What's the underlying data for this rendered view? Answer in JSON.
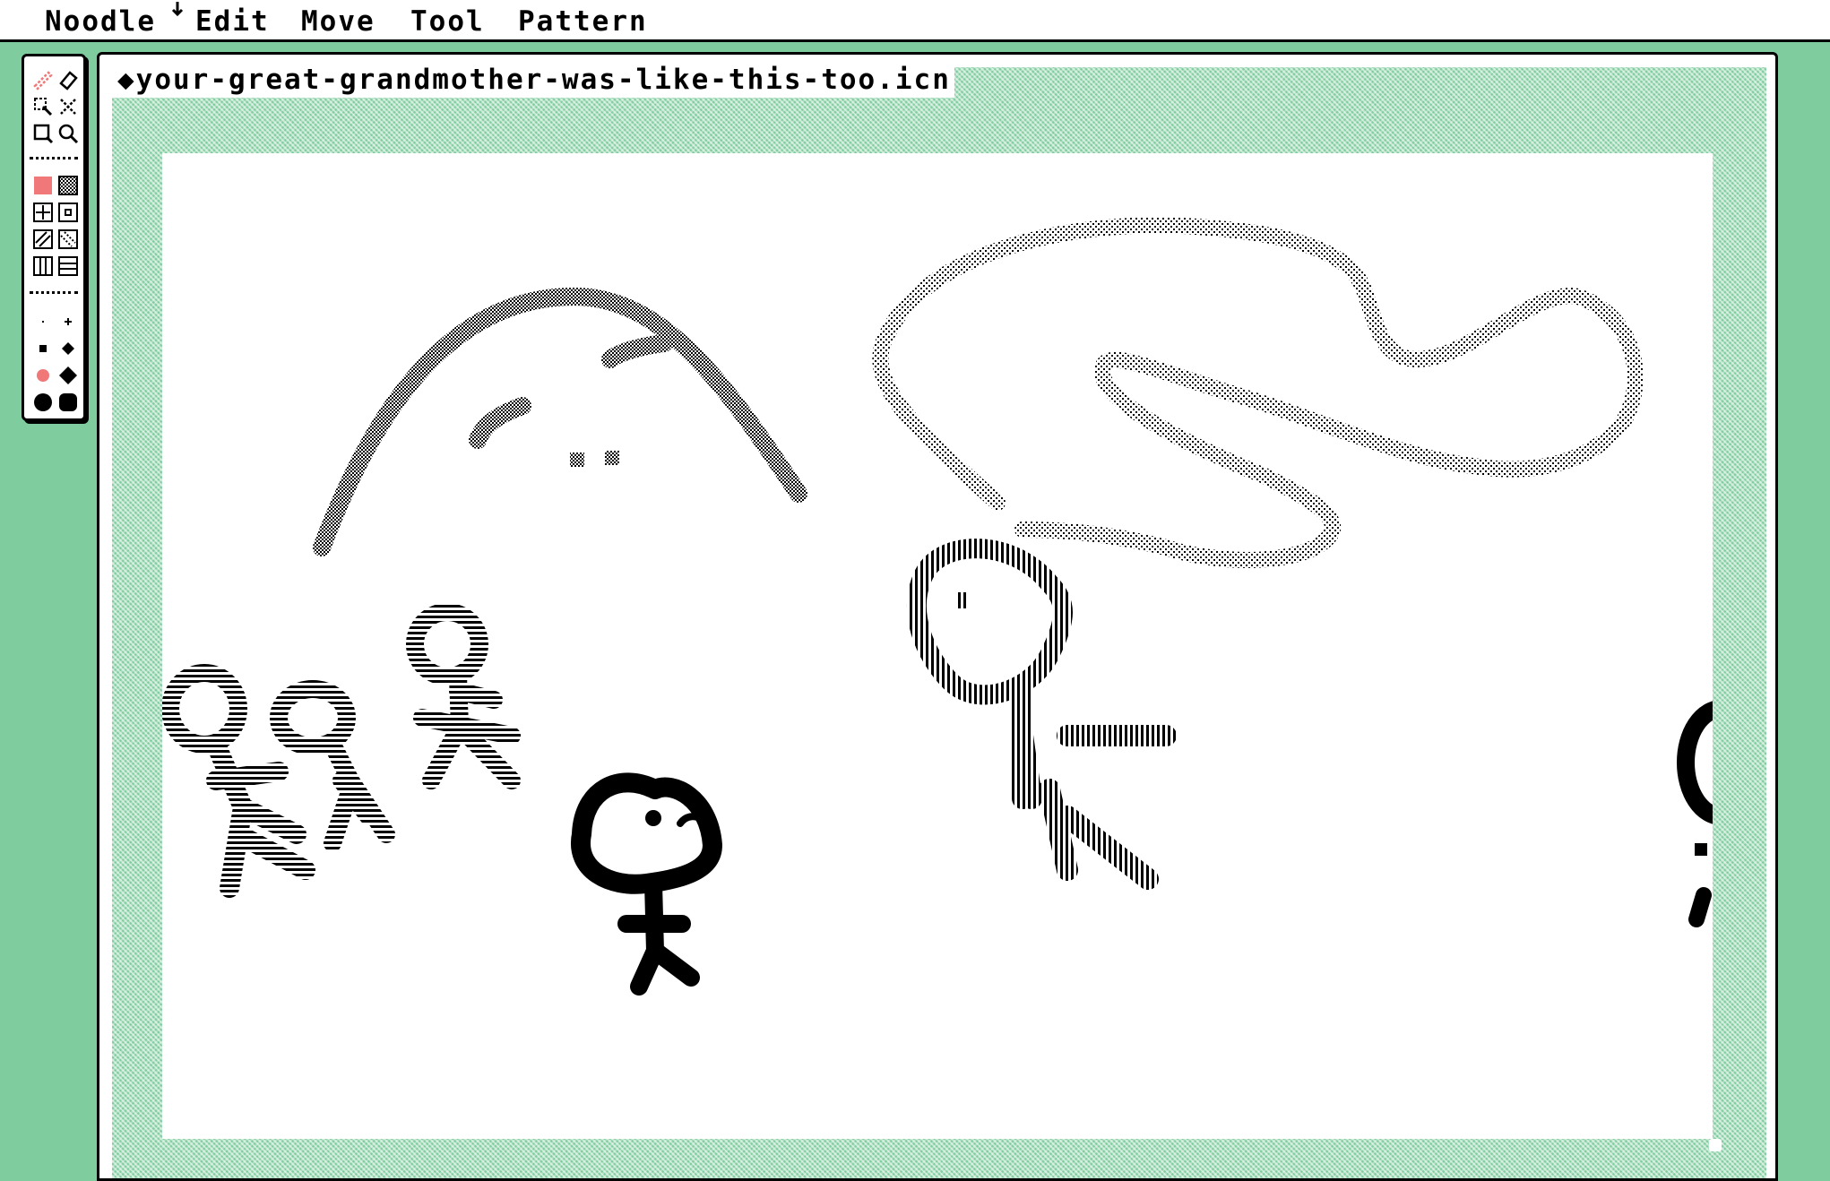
{
  "menubar": {
    "items": [
      "Noodle",
      "Edit",
      "Move",
      "Tool",
      "Pattern"
    ]
  },
  "window": {
    "title": "your-great-grandmother-was-like-this-too.icn"
  },
  "toolbox": {
    "tools": [
      {
        "name": "pencil-icon",
        "selected": true
      },
      {
        "name": "eraser-icon"
      },
      {
        "name": "select-icon"
      },
      {
        "name": "move-icon"
      },
      {
        "name": "rect-select-icon"
      },
      {
        "name": "zoom-icon"
      }
    ],
    "patterns": [
      "solid",
      "checker",
      "cross-box",
      "dot-box",
      "diagonal-right",
      "diagonal-left",
      "vertical-lines",
      "horizontal-lines"
    ],
    "selected_pattern": "solid",
    "brush_sizes": [
      "1",
      "2",
      "3",
      "4",
      "5",
      "6",
      "7",
      "8"
    ],
    "selected_brush": "5"
  },
  "colors": {
    "desktop": "#7fcc9e",
    "accent": "#f07878",
    "ink": "#000000"
  }
}
